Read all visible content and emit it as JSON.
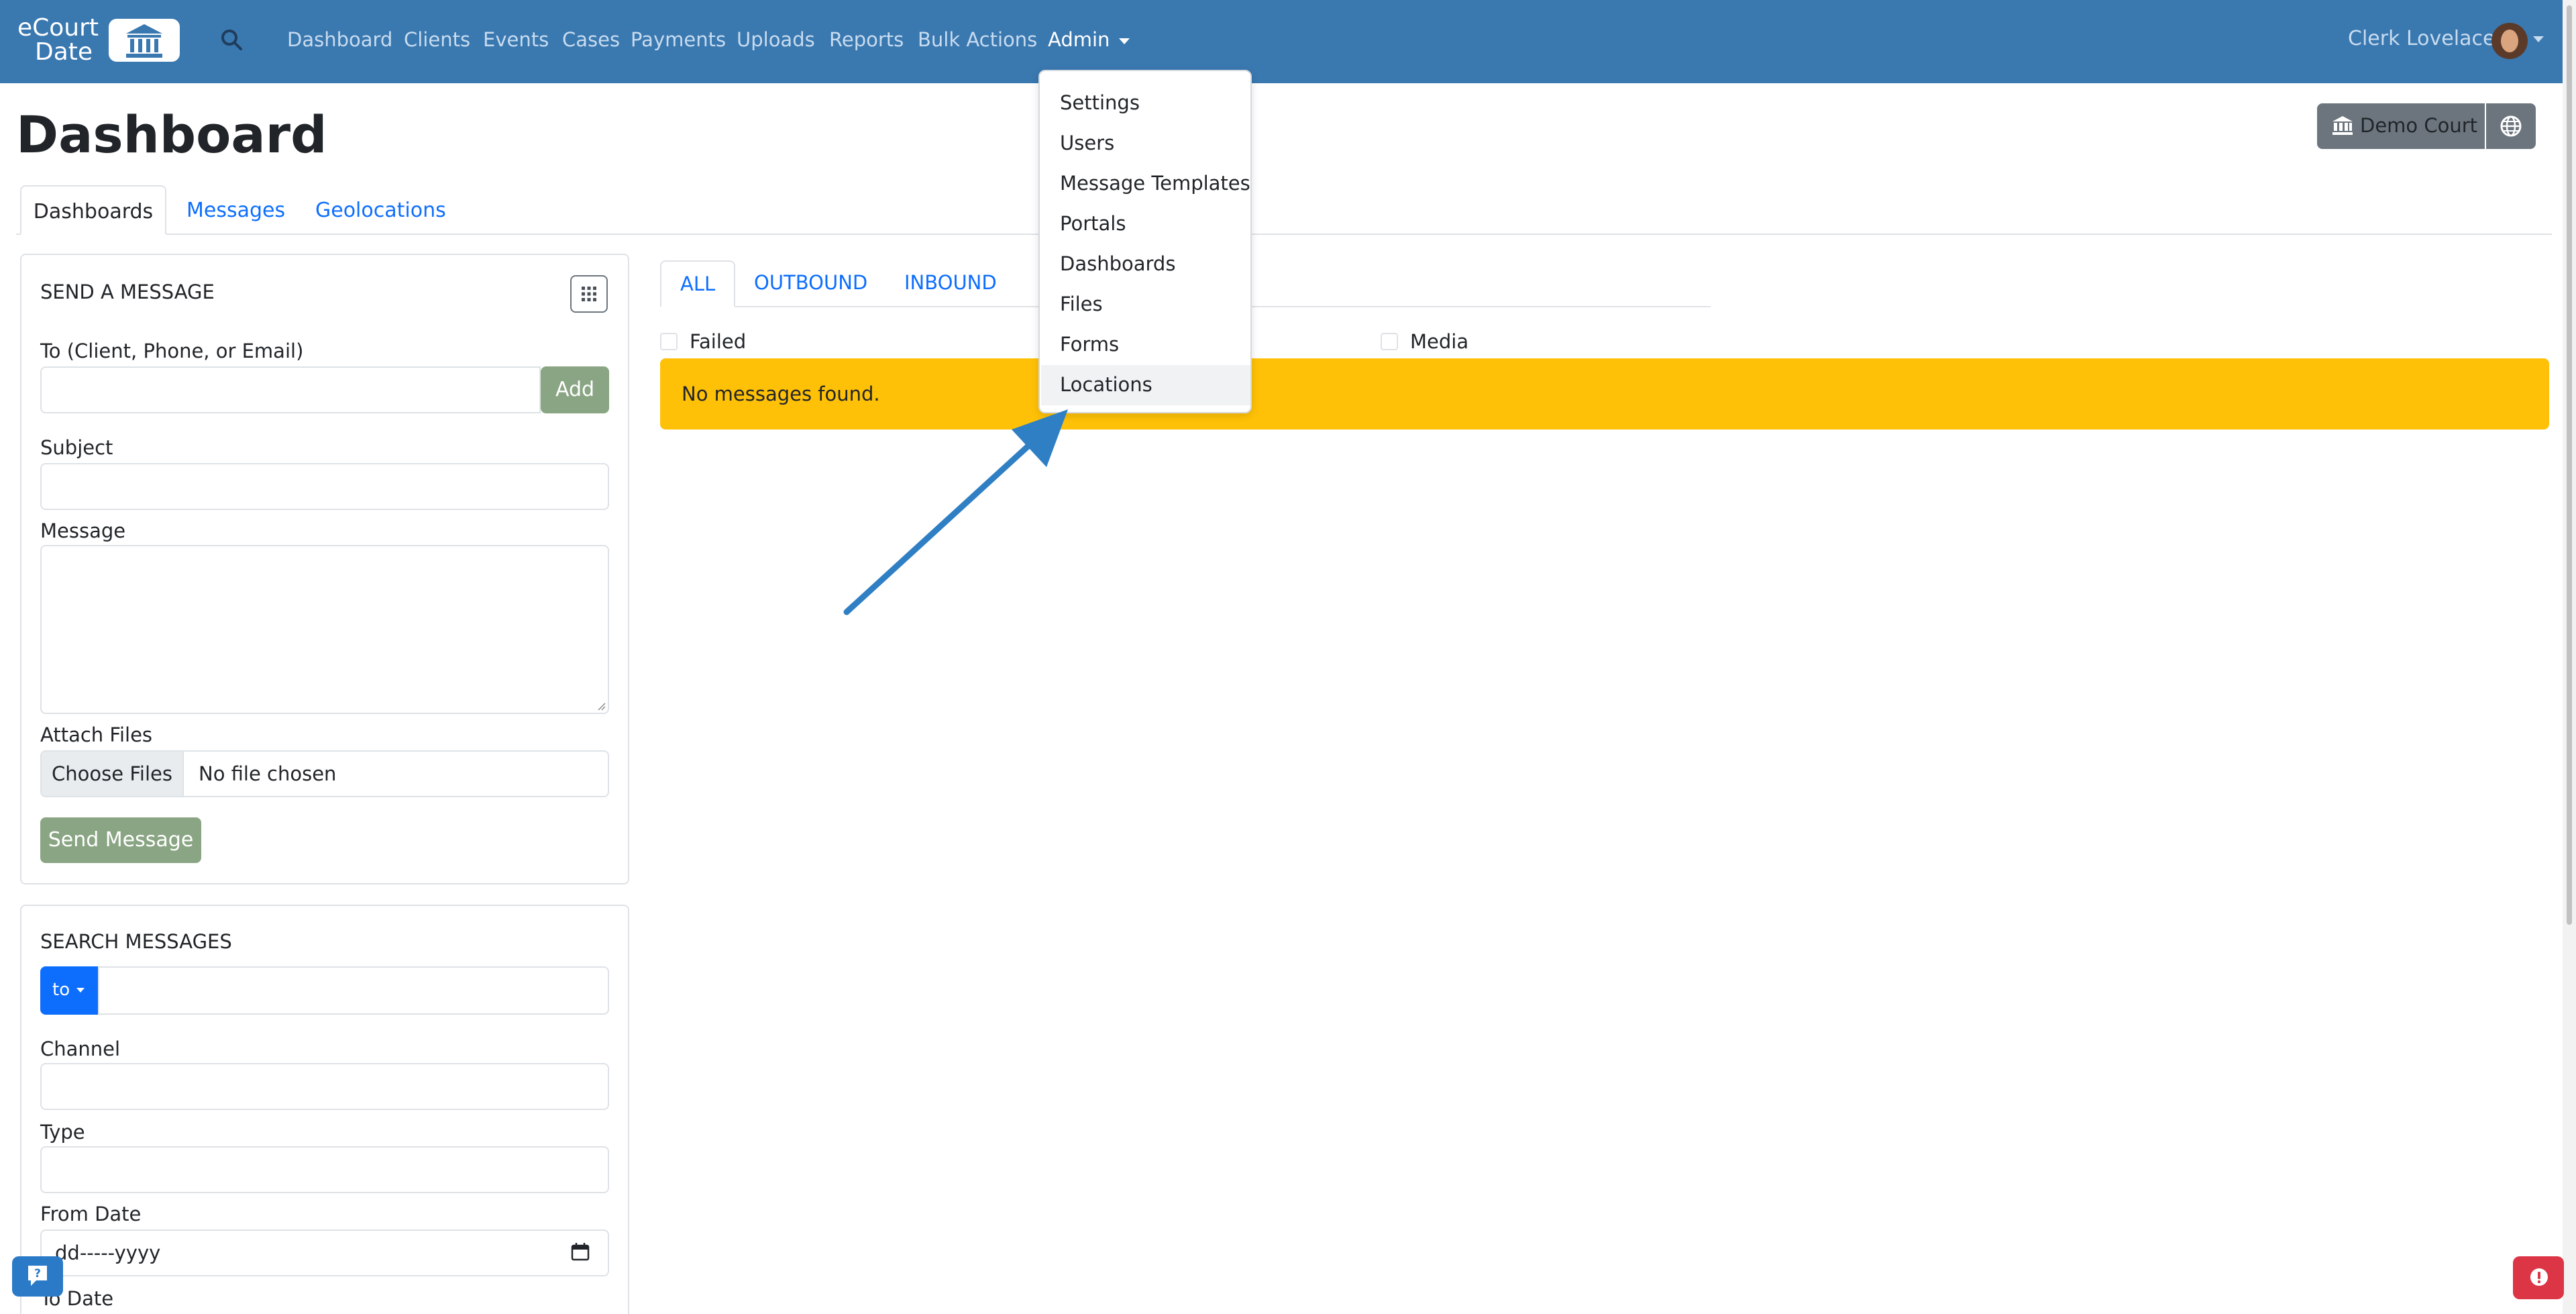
{
  "app": {
    "logo_line1": "eCourt",
    "logo_line2": "Date"
  },
  "nav": {
    "items": [
      {
        "label": "Dashboard"
      },
      {
        "label": "Clients"
      },
      {
        "label": "Events"
      },
      {
        "label": "Cases"
      },
      {
        "label": "Payments"
      },
      {
        "label": "Uploads"
      },
      {
        "label": "Reports"
      },
      {
        "label": "Bulk Actions"
      },
      {
        "label": "Admin"
      }
    ],
    "user_name": "Clerk Lovelace"
  },
  "admin_menu": {
    "items": [
      {
        "label": "Settings"
      },
      {
        "label": "Users"
      },
      {
        "label": "Message Templates"
      },
      {
        "label": "Portals"
      },
      {
        "label": "Dashboards"
      },
      {
        "label": "Files"
      },
      {
        "label": "Forms"
      },
      {
        "label": "Locations"
      }
    ]
  },
  "page": {
    "title": "Dashboard",
    "court_button": "Demo Court"
  },
  "tabs": [
    {
      "label": "Dashboards"
    },
    {
      "label": "Messages"
    },
    {
      "label": "Geolocations"
    }
  ],
  "send_message": {
    "title": "SEND A MESSAGE",
    "to_label": "To (Client, Phone, or Email)",
    "add_button": "Add",
    "subject_label": "Subject",
    "message_label": "Message",
    "attach_label": "Attach Files",
    "choose_files": "Choose Files",
    "no_file": "No file chosen",
    "send_button": "Send Message"
  },
  "search_messages": {
    "title": "SEARCH MESSAGES",
    "field_select": "to",
    "channel_label": "Channel",
    "type_label": "Type",
    "from_date_label": "From Date",
    "from_date_placeholder": "dd-----yyyy",
    "to_date_label": "To Date"
  },
  "messages_panel": {
    "tabs": [
      {
        "label": "ALL"
      },
      {
        "label": "OUTBOUND"
      },
      {
        "label": "INBOUND"
      }
    ],
    "filter_failed": "Failed",
    "filter_media": "Media",
    "empty_text": "No messages found."
  },
  "colors": {
    "navbar": "#3a78b0",
    "primary": "#0d6efd",
    "success_muted": "#8aa583",
    "warning": "#ffc107",
    "danger": "#dc3545",
    "annotation_arrow": "#2f7fc4"
  }
}
